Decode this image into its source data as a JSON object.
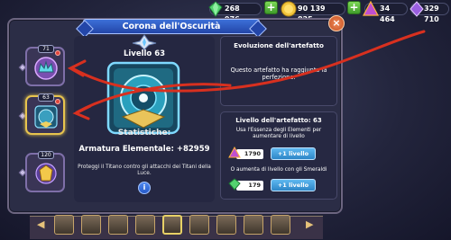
{
  "header": {
    "resources": [
      {
        "name": "gems",
        "value": "268 976",
        "icon": "gem-icon"
      },
      {
        "name": "gold",
        "value": "90 139 825",
        "icon": "gold-coin-icon"
      },
      {
        "name": "essence",
        "value": "34 464",
        "icon": "triangle-essence-icon"
      },
      {
        "name": "purple",
        "value": "329 710",
        "icon": "purple-crystal-icon"
      }
    ]
  },
  "modal": {
    "title": "Corona dell'Oscurità",
    "close_label": "×"
  },
  "slots": [
    {
      "level": "71",
      "type": "crown-artifact"
    },
    {
      "level": "63",
      "type": "crown-artifact",
      "selected": true
    },
    {
      "level": "120",
      "type": "chest-artifact"
    }
  ],
  "artifact": {
    "level_label": "Livello 63",
    "stats_label": "Statistiche:",
    "armor_label": "Armatura Elementale: +82959",
    "description": "Proteggi il Titano contro gli attacchi dei Titani della Luce.",
    "info_label": "i"
  },
  "evolution": {
    "title": "Evoluzione dell'artefatto",
    "message": "Questo artefatto ha raggiunto la perfezione."
  },
  "level_section": {
    "title": "Livello dell'artefatto: 63",
    "instruction": "Usa l'Essenza degli Elementi per aumentare di livello",
    "essence_cost": "1790",
    "essence_button": "+1 livello",
    "emerald_instruction": "O aumenta di livello con gli Smeraldi",
    "emerald_cost": "179",
    "emerald_button": "+1 livello"
  },
  "hero_bar": {
    "prev_arrow": "◀",
    "next_arrow": "▶",
    "heroes": [
      "hero-1",
      "hero-2",
      "hero-3",
      "hero-4",
      "hero-5",
      "hero-6",
      "hero-7",
      "hero-8"
    ]
  },
  "colors": {
    "accent_blue": "#2d86c7",
    "selected_gold": "#e7c44e",
    "annotation_red": "#d8301f"
  }
}
